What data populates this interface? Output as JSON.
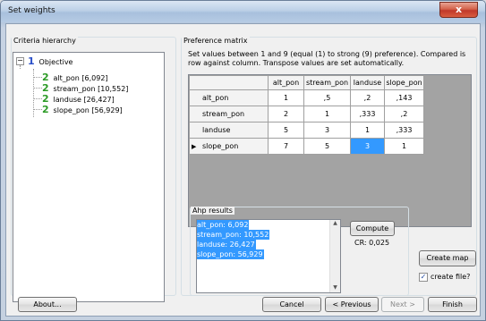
{
  "window": {
    "title": "Set weights",
    "close_glyph": "x"
  },
  "criteria": {
    "group_label": "Criteria hierarchy",
    "root": {
      "number": "1",
      "label": "Objective",
      "expander": "−"
    },
    "children": [
      {
        "number": "2",
        "label": "alt_pon [6,092]"
      },
      {
        "number": "2",
        "label": "stream_pon [10,552]"
      },
      {
        "number": "2",
        "label": "landuse [26,427]"
      },
      {
        "number": "2",
        "label": "slope_pon [56,929]"
      }
    ]
  },
  "preference": {
    "group_label": "Preference matrix",
    "description": "Set values between 1 and 9 (equal (1) to strong (9) preference). Compared is row against column. Transpose values are set automatically.",
    "columns": [
      "alt_pon",
      "stream_pon",
      "landuse",
      "slope_pon"
    ],
    "rows": [
      {
        "label": "alt_pon",
        "marker": "",
        "values": [
          "1",
          ",5",
          ",2",
          ",143"
        ]
      },
      {
        "label": "stream_pon",
        "marker": "",
        "values": [
          "2",
          "1",
          ",333",
          ",2"
        ]
      },
      {
        "label": "landuse",
        "marker": "",
        "values": [
          "5",
          "3",
          "1",
          ",333"
        ]
      },
      {
        "label": "slope_pon",
        "marker": "▶",
        "values": [
          "7",
          "5",
          "3",
          "1"
        ]
      }
    ],
    "selected_cell": {
      "row": 3,
      "col": 2
    }
  },
  "ahp": {
    "group_label": "Ahp results",
    "results": [
      "alt_pon: 6,092",
      "stream_pon: 10,552",
      "landuse: 26,427",
      "slope_pon: 56,929"
    ],
    "compute_label": "Compute",
    "cr_text": "CR: 0,025",
    "scroll_up": "▲",
    "scroll_down": "▼"
  },
  "actions": {
    "create_map_label": "Create map",
    "create_file_label": "create file?",
    "create_file_checked": true,
    "check_glyph": "✓"
  },
  "footer": {
    "about_label": "About...",
    "cancel_label": "Cancel",
    "previous_label": "< Previous",
    "next_label": "Next >",
    "finish_label": "Finish"
  },
  "colors": {
    "selection": "#3399ff",
    "level1": "#2a4fc9",
    "level2": "#2c9b26",
    "close": "#c0382a"
  },
  "icons": {
    "level_icon": "number-badge-icon",
    "row_marker": "current-row-icon"
  }
}
